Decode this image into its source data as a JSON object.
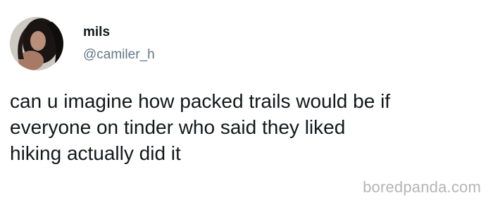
{
  "tweet": {
    "display_name": "mils",
    "handle": "@camiler_h",
    "text": "can u imagine how packed trails would be if\neveryone on tinder who said they liked\nhiking actually did it"
  },
  "watermark": {
    "text": "boredpanda.com"
  },
  "colors": {
    "background": "#ffffff",
    "name": "#14171a",
    "handle": "#657786",
    "text": "#14171a",
    "watermark": "#b5b5b5"
  },
  "icons": {
    "avatar": "profile-photo"
  }
}
